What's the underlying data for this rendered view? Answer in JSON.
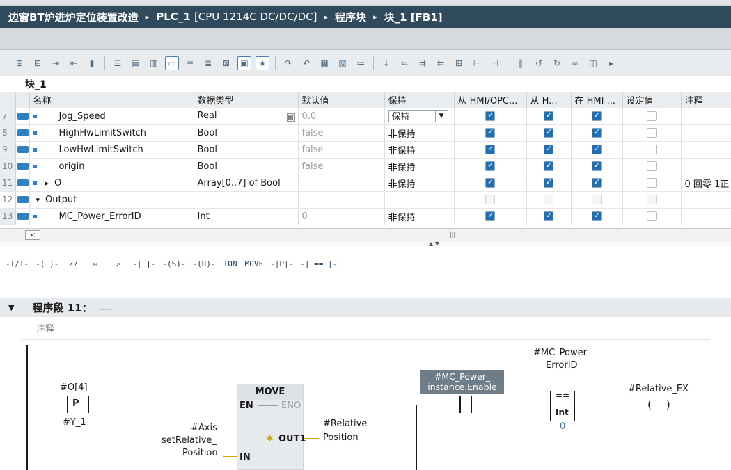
{
  "breadcrumb": {
    "project": "边窗BT炉进炉定位装置改造",
    "plc": "PLC_1",
    "cpu": "[CPU 1214C DC/DC/DC]",
    "folder": "程序块",
    "block": "块_1 [FB1]",
    "separator": "▸"
  },
  "toolbar_icons": [
    "insert-row-icon",
    "delete-row-icon",
    "indent-icon",
    "outdent-icon",
    "snapshot-icon",
    "list-icon",
    "list-alt-icon",
    "list-view-icon",
    "comment-icon",
    "network-add-icon",
    "network-del-icon",
    "network-expand-icon",
    "monitor-icon",
    "favorites-icon",
    "jump-icon",
    "call-icon",
    "stl-icon",
    "fbd-icon",
    "format-icon",
    "compile-icon",
    "move-icon",
    "align-icon",
    "align2-icon",
    "grid-icon",
    "step-icon",
    "step2-icon",
    "pause-icon",
    "goto-icon",
    "return-icon",
    "link-icon",
    "view-icon",
    "more-icon"
  ],
  "block_name": "块_1",
  "table": {
    "headers": [
      "名称",
      "数据类型",
      "默认值",
      "保持",
      "从 HMI/OPC...",
      "从 H...",
      "在 HMI ...",
      "设定值",
      "注释"
    ],
    "rows": [
      {
        "num": "7",
        "name": "Jog_Speed",
        "type": "Real",
        "default": "0.0",
        "retain": "保持",
        "editing": true,
        "hmi1": true,
        "hmi2": true,
        "hmi3": true,
        "setpoint": false,
        "comment": "",
        "indent": 2
      },
      {
        "num": "8",
        "name": "HighHwLimitSwitch",
        "type": "Bool",
        "default": "false",
        "retain": "非保持",
        "hmi1": true,
        "hmi2": true,
        "hmi3": true,
        "setpoint": false,
        "comment": "",
        "indent": 2
      },
      {
        "num": "9",
        "name": "LowHwLimitSwitch",
        "type": "Bool",
        "default": "false",
        "retain": "非保持",
        "hmi1": true,
        "hmi2": true,
        "hmi3": true,
        "setpoint": false,
        "comment": "",
        "indent": 2
      },
      {
        "num": "10",
        "name": "origin",
        "type": "Bool",
        "default": "false",
        "retain": "非保持",
        "hmi1": true,
        "hmi2": true,
        "hmi3": true,
        "setpoint": false,
        "comment": "",
        "indent": 2
      },
      {
        "num": "11",
        "name": "O",
        "type": "Array[0..7] of Bool",
        "default": "",
        "retain": "非保持",
        "hmi1": true,
        "hmi2": true,
        "hmi3": true,
        "setpoint": false,
        "comment": "0 回零 1正",
        "indent": 1,
        "expander": "▸"
      },
      {
        "num": "12",
        "name": "Output",
        "type": "",
        "default": "",
        "retain": "",
        "group": true,
        "expander": "▾"
      },
      {
        "num": "13",
        "name": "MC_Power_ErrorID",
        "type": "Int",
        "default": "0",
        "retain": "非保持",
        "hmi1": true,
        "hmi2": true,
        "hmi3": true,
        "setpoint": false,
        "comment": "",
        "indent": 2
      }
    ]
  },
  "scroll": {
    "left_label": "<",
    "thumb_label": "|||",
    "split_arrows": "▲ ▼"
  },
  "ladder_tools": [
    "-I/I-",
    "-( )-",
    "??",
    "↦",
    "↗",
    "-| |-",
    "-(S)-",
    "-(R)-",
    "TON",
    "MOVE",
    "-|P|-",
    "-| == |-"
  ],
  "segment": {
    "caret": "▼",
    "title": "程序段 11：",
    "dots": ".....",
    "comment": "注释"
  },
  "ladder": {
    "contact_top": "#O[4]",
    "contact_letter": "P",
    "contact_bottom": "#Y_1",
    "move_title": "MOVE",
    "en": "EN",
    "eno": "ENO",
    "out1": "OUT1",
    "in": "IN",
    "in_operand_l1": "#Axis_",
    "in_operand_l2": "setRelative_",
    "in_operand_l3": "Position",
    "out_operand_l1": "#Relative_",
    "out_operand_l2": "Position",
    "inst_l1": "#MC_Power_",
    "inst_l2": "instance.Enable",
    "cmp_top_l1": "#MC_Power_",
    "cmp_top_l2": "ErrorID",
    "cmp_op": "==",
    "cmp_type": "Int",
    "cmp_val": "0",
    "coil": "#Relative_EX"
  },
  "colors": {
    "title_bg": "#2f4a5c",
    "checkbox": "#1f6fb5",
    "accent": "#2f7fc1"
  }
}
